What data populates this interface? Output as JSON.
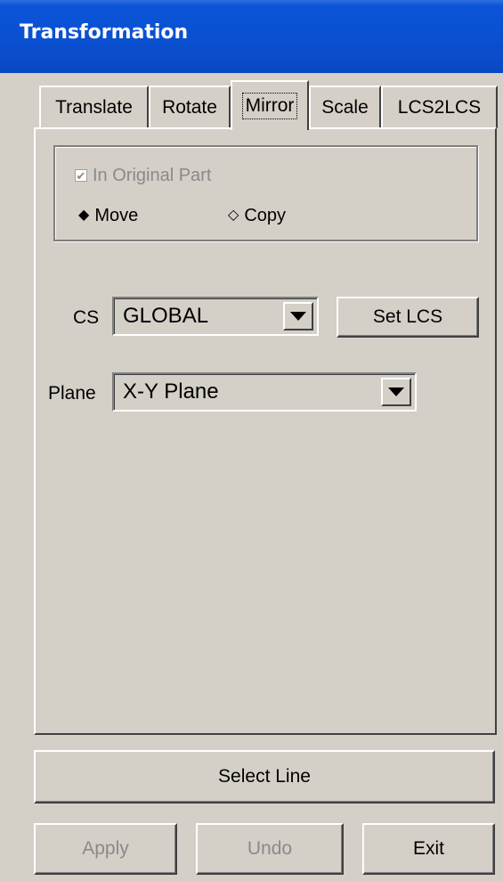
{
  "window": {
    "title": "Transformation"
  },
  "tabs": [
    {
      "label": "Translate",
      "active": false
    },
    {
      "label": "Rotate",
      "active": false
    },
    {
      "label": "Mirror",
      "active": true
    },
    {
      "label": "Scale",
      "active": false
    },
    {
      "label": "LCS2LCS",
      "active": false
    }
  ],
  "options": {
    "in_original_part": {
      "label": "In Original Part",
      "checked": true,
      "enabled": false
    },
    "mode": {
      "move_label": "Move",
      "copy_label": "Copy",
      "selected": "Move"
    }
  },
  "cs": {
    "label": "CS",
    "value": "GLOBAL",
    "set_lcs_label": "Set LCS"
  },
  "plane": {
    "label": "Plane",
    "value": "X-Y Plane"
  },
  "actions": {
    "select_line_label": "Select Line",
    "apply_label": "Apply",
    "undo_label": "Undo",
    "exit_label": "Exit"
  },
  "colors": {
    "titlebar": "#0a4fcf",
    "face": "#d4d0c8",
    "disabled_text": "#8a8a8a"
  }
}
